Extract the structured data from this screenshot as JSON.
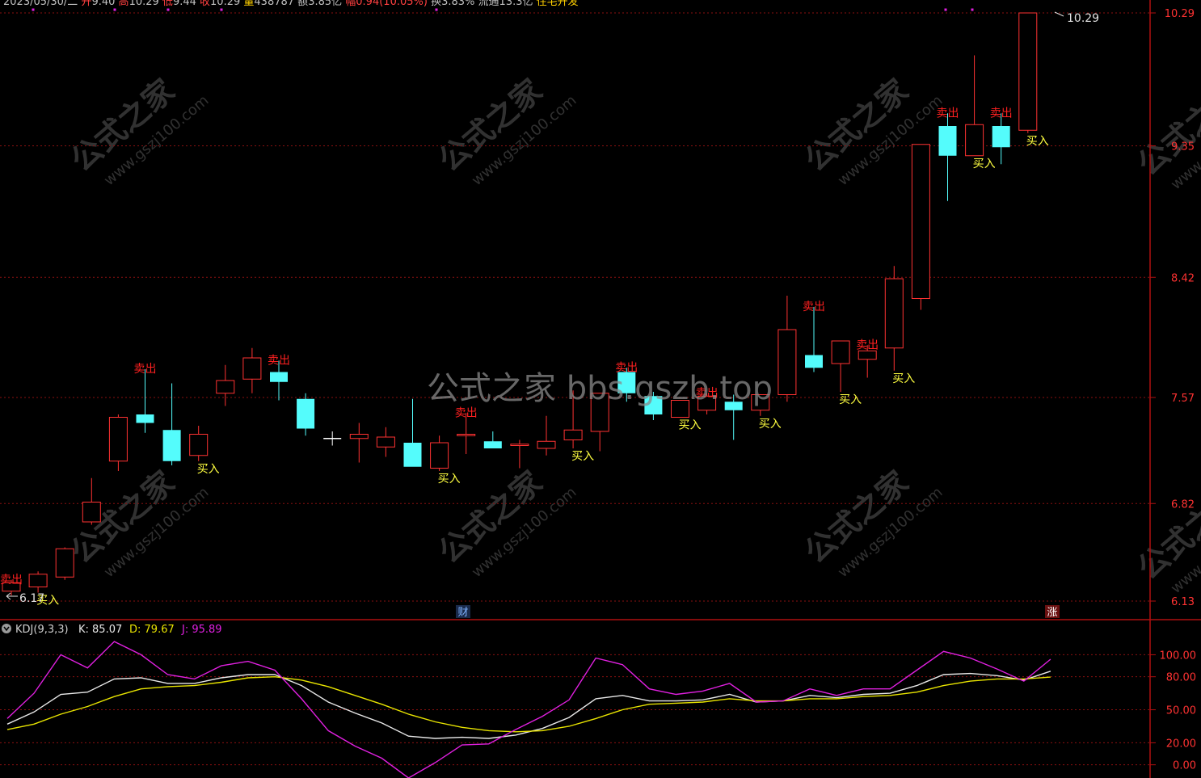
{
  "header": {
    "segments": [
      {
        "text": "2023/05/30/二 ",
        "color": "#c0c0c0"
      },
      {
        "text": "开",
        "color": "#ff4040"
      },
      {
        "text": "9.40 ",
        "color": "#c0c0c0"
      },
      {
        "text": "高",
        "color": "#ff4040"
      },
      {
        "text": "10.29 ",
        "color": "#c0c0c0"
      },
      {
        "text": "低",
        "color": "#ff4040"
      },
      {
        "text": "9.44 ",
        "color": "#c0c0c0"
      },
      {
        "text": "收",
        "color": "#ff4040"
      },
      {
        "text": "10.29 ",
        "color": "#c0c0c0"
      },
      {
        "text": "量",
        "color": "#ffd000"
      },
      {
        "text": "438787 ",
        "color": "#c0c0c0"
      },
      {
        "text": "额",
        "color": "#c0c0c0"
      },
      {
        "text": "3.85亿 ",
        "color": "#c0c0c0"
      },
      {
        "text": "幅",
        "color": "#ff4040"
      },
      {
        "text": "0.94(10.05%) ",
        "color": "#ff4040"
      },
      {
        "text": "换",
        "color": "#c0c0c0"
      },
      {
        "text": "3.83% ",
        "color": "#c0c0c0"
      },
      {
        "text": "流通",
        "color": "#c0c0c0"
      },
      {
        "text": "13.3亿 ",
        "color": "#c0c0c0"
      },
      {
        "text": "住宅开发",
        "color": "#ffd000"
      }
    ]
  },
  "watermark": {
    "main": "公式之家 bbs.gszb.top",
    "tile_cn": "公式之家",
    "tile_url": "www.gszj100.com"
  },
  "markers": {
    "cai": "财",
    "zhang": "涨"
  },
  "signals": {
    "buy_label": "买入",
    "sell_label": "卖出"
  },
  "price_annotations": {
    "high_label": "10.29",
    "low_label": "6.17"
  },
  "kdj_panel": {
    "title": "KDJ(9,3,3)",
    "k_label": "K: 85.07",
    "d_label": "D: 79.67",
    "j_label": "J: 95.89"
  },
  "chart_data": [
    {
      "type": "candlestick",
      "y_axis_ticks": [
        "10.29",
        "9.35",
        "8.42",
        "7.57",
        "6.82",
        "6.13"
      ],
      "ylim": [
        6.13,
        10.29
      ],
      "colors": {
        "up": "#ff3232",
        "down": "#54fcfc",
        "doji": "#ffffff"
      },
      "candles": [
        {
          "o": 6.2,
          "h": 6.28,
          "l": 6.17,
          "c": 6.26,
          "buy": false,
          "sell": true
        },
        {
          "o": 6.23,
          "h": 6.34,
          "l": 6.19,
          "c": 6.32,
          "buy": true,
          "sell": false
        },
        {
          "o": 6.3,
          "h": 6.51,
          "l": 6.28,
          "c": 6.5,
          "buy": false,
          "sell": false
        },
        {
          "o": 6.69,
          "h": 7.0,
          "l": 6.67,
          "c": 6.83,
          "buy": false,
          "sell": false
        },
        {
          "o": 7.12,
          "h": 7.45,
          "l": 7.05,
          "c": 7.43,
          "buy": false,
          "sell": false
        },
        {
          "o": 7.45,
          "h": 7.77,
          "l": 7.32,
          "c": 7.39,
          "buy": false,
          "sell": true
        },
        {
          "o": 7.34,
          "h": 7.67,
          "l": 7.09,
          "c": 7.12,
          "buy": false,
          "sell": false
        },
        {
          "o": 7.16,
          "h": 7.37,
          "l": 7.12,
          "c": 7.31,
          "buy": true,
          "sell": false
        },
        {
          "o": 7.6,
          "h": 7.8,
          "l": 7.51,
          "c": 7.69,
          "buy": false,
          "sell": false
        },
        {
          "o": 7.7,
          "h": 7.92,
          "l": 7.6,
          "c": 7.85,
          "buy": false,
          "sell": false
        },
        {
          "o": 7.75,
          "h": 7.83,
          "l": 7.55,
          "c": 7.68,
          "buy": false,
          "sell": true
        },
        {
          "o": 7.56,
          "h": 7.6,
          "l": 7.3,
          "c": 7.35,
          "buy": false,
          "sell": false
        },
        {
          "o": 7.28,
          "h": 7.33,
          "l": 7.23,
          "c": 7.28,
          "buy": false,
          "sell": false
        },
        {
          "o": 7.28,
          "h": 7.39,
          "l": 7.11,
          "c": 7.31,
          "buy": false,
          "sell": false
        },
        {
          "o": 7.22,
          "h": 7.36,
          "l": 7.15,
          "c": 7.29,
          "buy": false,
          "sell": false
        },
        {
          "o": 7.25,
          "h": 7.56,
          "l": 7.09,
          "c": 7.08,
          "buy": false,
          "sell": false
        },
        {
          "o": 7.07,
          "h": 7.3,
          "l": 7.05,
          "c": 7.25,
          "buy": true,
          "sell": false
        },
        {
          "o": 7.3,
          "h": 7.46,
          "l": 7.17,
          "c": 7.31,
          "buy": false,
          "sell": true
        },
        {
          "o": 7.26,
          "h": 7.33,
          "l": 7.21,
          "c": 7.21,
          "buy": false,
          "sell": false
        },
        {
          "o": 7.23,
          "h": 7.27,
          "l": 7.07,
          "c": 7.24,
          "buy": false,
          "sell": false
        },
        {
          "o": 7.21,
          "h": 7.44,
          "l": 7.16,
          "c": 7.26,
          "buy": false,
          "sell": false
        },
        {
          "o": 7.27,
          "h": 7.62,
          "l": 7.21,
          "c": 7.34,
          "buy": true,
          "sell": false
        },
        {
          "o": 7.33,
          "h": 7.6,
          "l": 7.19,
          "c": 7.6,
          "buy": false,
          "sell": false
        },
        {
          "o": 7.75,
          "h": 7.78,
          "l": 7.54,
          "c": 7.6,
          "buy": false,
          "sell": true
        },
        {
          "o": 7.58,
          "h": 7.61,
          "l": 7.41,
          "c": 7.45,
          "buy": false,
          "sell": false
        },
        {
          "o": 7.43,
          "h": 7.55,
          "l": 7.43,
          "c": 7.55,
          "buy": true,
          "sell": false
        },
        {
          "o": 7.48,
          "h": 7.6,
          "l": 7.45,
          "c": 7.58,
          "buy": false,
          "sell": true
        },
        {
          "o": 7.54,
          "h": 7.59,
          "l": 7.27,
          "c": 7.48,
          "buy": false,
          "sell": false
        },
        {
          "o": 7.48,
          "h": 7.59,
          "l": 7.44,
          "c": 7.59,
          "buy": true,
          "sell": false
        },
        {
          "o": 7.59,
          "h": 8.29,
          "l": 7.54,
          "c": 8.05,
          "buy": false,
          "sell": false
        },
        {
          "o": 7.87,
          "h": 8.21,
          "l": 7.75,
          "c": 7.78,
          "buy": false,
          "sell": true
        },
        {
          "o": 7.81,
          "h": 7.97,
          "l": 7.61,
          "c": 7.97,
          "buy": true,
          "sell": false
        },
        {
          "o": 7.84,
          "h": 7.94,
          "l": 7.71,
          "c": 7.9,
          "buy": false,
          "sell": true
        },
        {
          "o": 7.92,
          "h": 8.5,
          "l": 7.76,
          "c": 8.41,
          "buy": true,
          "sell": false
        },
        {
          "o": 8.27,
          "h": 9.35,
          "l": 8.19,
          "c": 9.36,
          "buy": false,
          "sell": false
        },
        {
          "o": 9.49,
          "h": 9.58,
          "l": 8.96,
          "c": 9.28,
          "buy": false,
          "sell": true
        },
        {
          "o": 9.28,
          "h": 9.99,
          "l": 9.28,
          "c": 9.5,
          "buy": true,
          "sell": false
        },
        {
          "o": 9.49,
          "h": 9.58,
          "l": 9.22,
          "c": 9.34,
          "buy": false,
          "sell": true
        },
        {
          "o": 9.46,
          "h": 10.29,
          "l": 9.44,
          "c": 10.29,
          "buy": true,
          "sell": false
        }
      ]
    },
    {
      "type": "line",
      "title": "KDJ(9,3,3)",
      "y_axis_ticks": [
        "100.00",
        "80.00",
        "50.00",
        "20.00",
        "0.00"
      ],
      "ylim": [
        -12,
        115
      ],
      "series": [
        {
          "name": "K",
          "color": "#e8e8e8",
          "values": [
            37,
            48,
            64,
            66,
            78,
            79,
            74,
            74,
            79,
            82,
            82,
            72,
            57,
            47,
            38,
            26,
            24,
            25,
            24,
            27,
            33,
            43,
            60,
            63,
            58,
            58,
            59,
            64,
            57,
            58,
            63,
            61,
            64,
            65,
            72,
            82,
            83,
            81,
            77,
            85.07
          ]
        },
        {
          "name": "D",
          "color": "#e8e400",
          "values": [
            32,
            37,
            46,
            53,
            62,
            69,
            71,
            72,
            75,
            79,
            80,
            77,
            71,
            63,
            55,
            46,
            39,
            34,
            31,
            30,
            31,
            35,
            42,
            50,
            55,
            56,
            57,
            60,
            58,
            58,
            60,
            60,
            62,
            63,
            66,
            72,
            76,
            78,
            78,
            79.67
          ]
        },
        {
          "name": "J",
          "color": "#e020e0",
          "values": [
            42,
            65,
            100,
            88,
            112,
            100,
            82,
            78,
            90,
            94,
            86,
            60,
            31,
            17,
            6,
            -12,
            2,
            18,
            19,
            32,
            44,
            59,
            97,
            91,
            69,
            64,
            67,
            74,
            57,
            58,
            69,
            63,
            69,
            69,
            86,
            103,
            97,
            87,
            76,
            95.89
          ]
        }
      ]
    }
  ]
}
